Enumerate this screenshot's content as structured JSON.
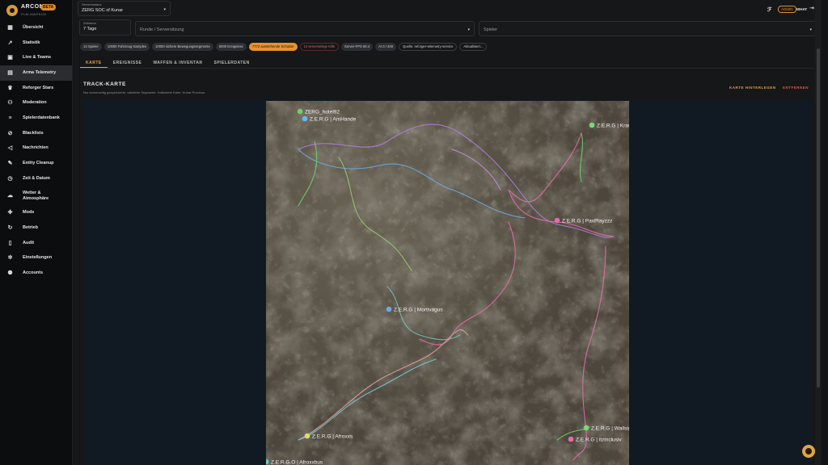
{
  "brand": {
    "name": "ARCON",
    "badge": "BETA",
    "subtitle": "FLM-MARKUS"
  },
  "nav": [
    {
      "label": "Übersicht",
      "icon": "dashboard-icon"
    },
    {
      "label": "Statistik",
      "icon": "chart-icon"
    },
    {
      "label": "Live & Teams",
      "icon": "live-icon"
    },
    {
      "label": "Arma Telemetry",
      "icon": "map-icon",
      "active": true
    },
    {
      "label": "Reforger Stars",
      "icon": "trophy-icon"
    },
    {
      "label": "Moderation",
      "icon": "users-icon"
    },
    {
      "label": "Spielerdatenbank",
      "icon": "database-icon"
    },
    {
      "label": "Blacklists",
      "icon": "ban-icon"
    },
    {
      "label": "Nachrichten",
      "icon": "megaphone-icon"
    },
    {
      "label": "Entity Cleanup",
      "icon": "trash-icon"
    },
    {
      "label": "Zeit & Datum",
      "icon": "clock-icon"
    },
    {
      "label": "Wetter & Atmosphäre",
      "icon": "cloud-icon"
    },
    {
      "label": "Mods",
      "icon": "puzzle-icon"
    },
    {
      "label": "Betrieb",
      "icon": "refresh-icon"
    },
    {
      "label": "Audit",
      "icon": "document-icon"
    },
    {
      "label": "Einstellungen",
      "icon": "gear-icon"
    },
    {
      "label": "Accounts",
      "icon": "accounts-icon"
    }
  ],
  "header": {
    "server_label": "Serverinstanz",
    "server_value": "ZERG SOC of Kunar",
    "timeframe_label": "Zeitraum",
    "timeframe_value": "7 Tage",
    "round_placeholder": "Runde / Serversitzung",
    "player_placeholder": "Spieler",
    "role": "ADMIN",
    "user": "WHAT"
  },
  "chips": [
    {
      "text": "13 Spieler",
      "style": ""
    },
    {
      "text": "10000 Fahrzeug-Samples",
      "style": ""
    },
    {
      "text": "10000 sichere Bewegungssegmente",
      "style": ""
    },
    {
      "text": "5000 Ereignisse",
      "style": ""
    },
    {
      "text": "7772 ausstehende Schüsse",
      "style": "orange"
    },
    {
      "text": "12 serverseitige Kills",
      "style": "red"
    },
    {
      "text": "Server-FPS 60.4",
      "style": ""
    },
    {
      "text": "AI 0 / 200",
      "style": ""
    },
    {
      "text": "Quelle: reforger-telemetry-service",
      "style": "outline"
    },
    {
      "text": "Aktualisiert...",
      "style": "outline"
    }
  ],
  "tabs": [
    {
      "label": "KARTE",
      "active": true
    },
    {
      "label": "EREIGNISSE",
      "active": false
    },
    {
      "label": "WAFFEN & INVENTAR",
      "active": false
    },
    {
      "label": "SPIELERDATEN",
      "active": false
    }
  ],
  "section": {
    "title": "TRACK-KARTE",
    "subtitle": "Nur serverseitig gespeicherte, validierte Segmente. Kalibrierte Karte: Kunar Province.",
    "save_label": "KARTE HINTERLEGEN",
    "remove_label": "ENTFERNEN"
  },
  "map_players": [
    {
      "name": "ZERG_hotel92",
      "color": "#6ad06a"
    },
    {
      "name": "Z.E.R.G | AmHande",
      "color": "#6ab8e8"
    },
    {
      "name": "Z.E.R.G | KrawallAtze",
      "color": "#7ad87a"
    },
    {
      "name": "Z.E.R.G | PaxPlayzzz",
      "color": "#e86aa8"
    },
    {
      "name": "Z.E.R.G | Mortivagus",
      "color": "#6aa8e8"
    },
    {
      "name": "Z.E.R.G | Wallsigosh",
      "color": "#7ad87a"
    },
    {
      "name": "Z.E.R.G | itzinclusiv",
      "color": "#e86aa8"
    },
    {
      "name": "Z.E.R.G | Afroxxs",
      "color": "#d8e060"
    },
    {
      "name": "Z.E.R.G.O | Afroxxbus",
      "color": "#6ad0c8"
    }
  ]
}
